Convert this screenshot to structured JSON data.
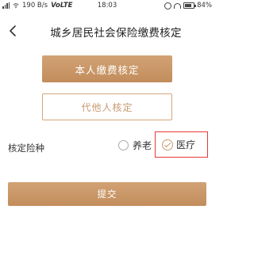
{
  "status_bar": {
    "signal_text": "",
    "network_speed": "190 B/s",
    "network_type": "VoLTE",
    "time": "18:03",
    "battery": "84%"
  },
  "header": {
    "title": "城乡居民社会保险缴费核定",
    "back_icon": "back-arrow-icon"
  },
  "buttons": {
    "self_label": "本人缴费核定",
    "other_label": "代他人核定",
    "submit_label": "提交"
  },
  "insurance_type": {
    "label": "核定险种",
    "options": [
      {
        "label": "养老",
        "selected": false
      },
      {
        "label": "医疗",
        "selected": true
      }
    ]
  },
  "colors": {
    "accent": "#c79a6f",
    "highlight_box": "#e53935"
  }
}
